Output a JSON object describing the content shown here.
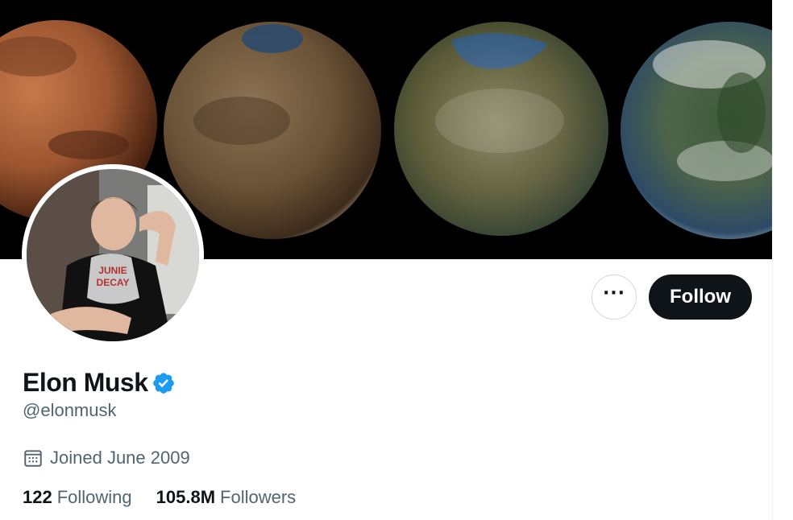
{
  "profile": {
    "display_name": "Elon Musk",
    "handle": "@elonmusk",
    "joined": "Joined June 2009",
    "verified": true
  },
  "actions": {
    "more_label": "···",
    "follow_label": "Follow"
  },
  "stats": {
    "following_count": "122",
    "following_label": "Following",
    "followers_count": "105.8M",
    "followers_label": "Followers"
  },
  "icons": {
    "verified": "verified-badge-icon",
    "calendar": "calendar-icon",
    "more": "more-icon"
  },
  "colors": {
    "text_primary": "#0f1419",
    "text_secondary": "#536471",
    "verified_blue": "#1d9bf0",
    "follow_bg": "#0f1419",
    "border": "#cfd9de"
  }
}
